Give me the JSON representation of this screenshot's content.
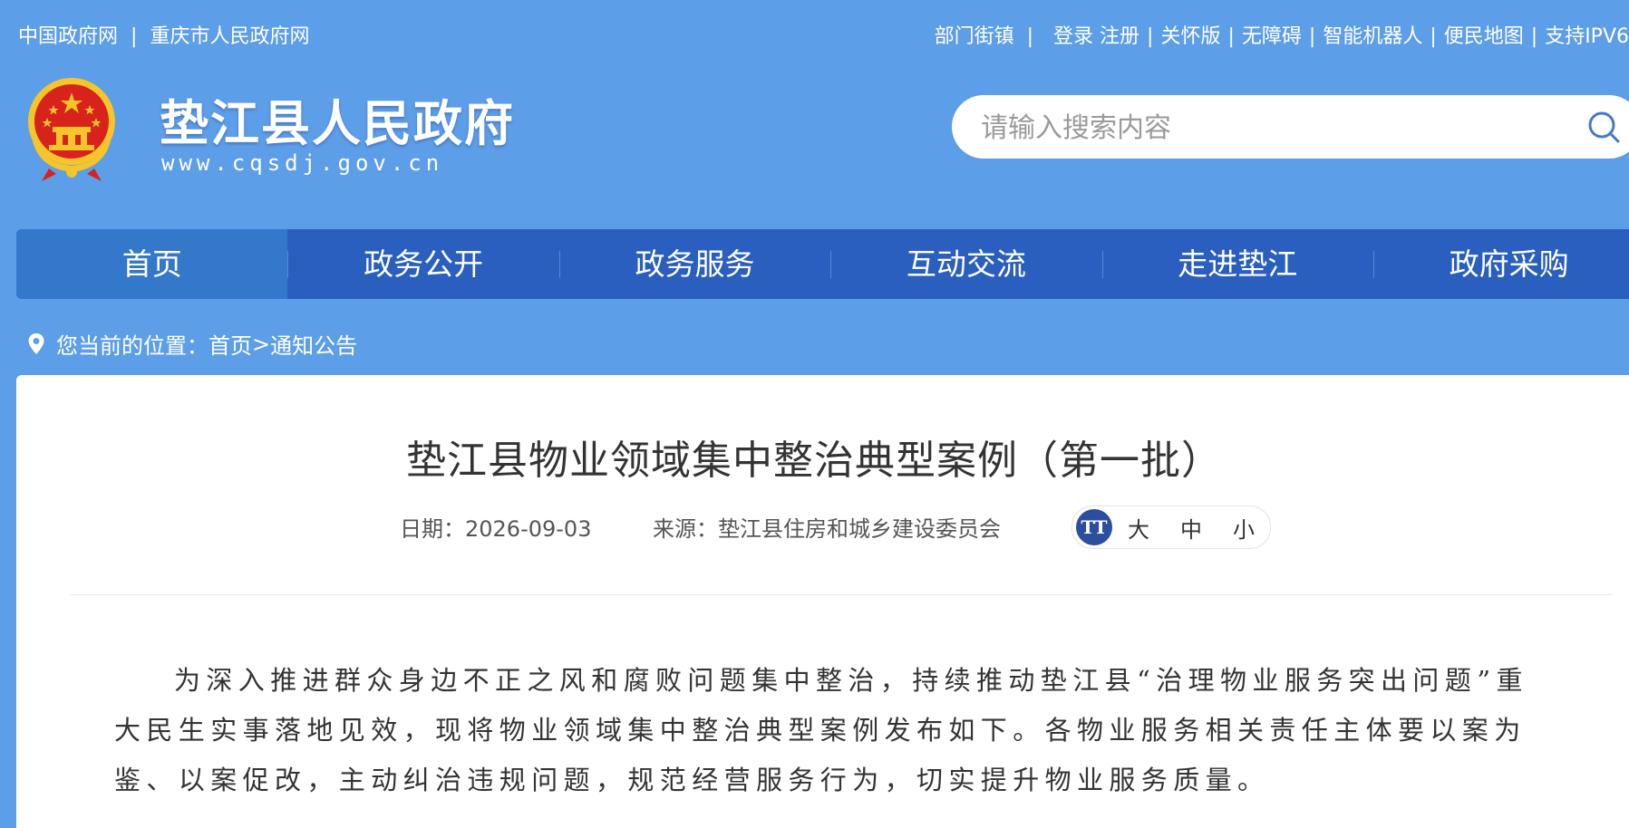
{
  "topbar": {
    "left_links": [
      "中国政府网",
      "重庆市人民政府网"
    ],
    "separator": "|",
    "dept_link": "部门街镇",
    "right_links": [
      "登录 注册",
      "关怀版",
      "无障碍",
      "智能机器人",
      "便民地图",
      "支持IPV6"
    ]
  },
  "header": {
    "site_title": "垫江县人民政府",
    "site_url": "www.cqsdj.gov.cn",
    "emblem_icon": "national-emblem-icon"
  },
  "search": {
    "placeholder": "请输入搜索内容",
    "icon": "search-icon"
  },
  "nav": {
    "items": [
      "首页",
      "政务公开",
      "政务服务",
      "互动交流",
      "走进垫江",
      "政府采购"
    ],
    "active_index": 0
  },
  "breadcrumb": {
    "prefix": "您当前的位置：",
    "home": "首页",
    "arrow": " >",
    "current": "通知公告"
  },
  "article": {
    "title": "垫江县物业领域集中整治典型案例（第一批）",
    "date_label": "日期：2026-09-03",
    "source_label": "来源：垫江县住房和城乡建设委员会",
    "font_size_icon": "TT",
    "font_sizes": [
      "大",
      "中",
      "小"
    ],
    "paragraph": "为深入推进群众身边不正之风和腐败问题集中整治，持续推动垫江县“治理物业服务突出问题”重大民生实事落地见效，现将物业领域集中整治典型案例发布如下。各物业服务相关责任主体要以案为鉴、以案促改，主动纠治违规问题，规范经营服务行为，切实提升物业服务质量。"
  },
  "colors": {
    "page_background": "#5d9ee8",
    "nav_background": "#2a5fc0",
    "nav_active": "#3478cc",
    "emblem_red": "#d8231d",
    "emblem_gold": "#f5c52a"
  }
}
